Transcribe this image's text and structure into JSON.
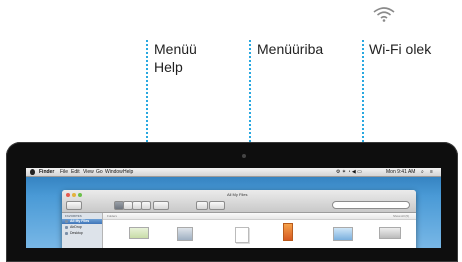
{
  "callouts": {
    "help_menu": "Menüü\nHelp",
    "menubar": "Menüüriba",
    "wifi": "Wi-Fi olek"
  },
  "icons": {
    "wifi_status": "wifi-icon",
    "apple_menu": "apple-icon"
  },
  "colors": {
    "callout_line": "#29a8e0",
    "desktop": "#4a9ad6"
  },
  "menubar": {
    "items": [
      "Finder",
      "File",
      "Edit",
      "View",
      "Go",
      "Window",
      "Help"
    ],
    "clock": "Mon 9:41 AM"
  },
  "finder": {
    "title": "All My Files",
    "sidebar_heading": "FAVORITES",
    "sidebar_items": [
      "All My Files",
      "AirDrop",
      "Desktop"
    ],
    "content_header": "Folders",
    "show_all": "Show All (5)"
  }
}
